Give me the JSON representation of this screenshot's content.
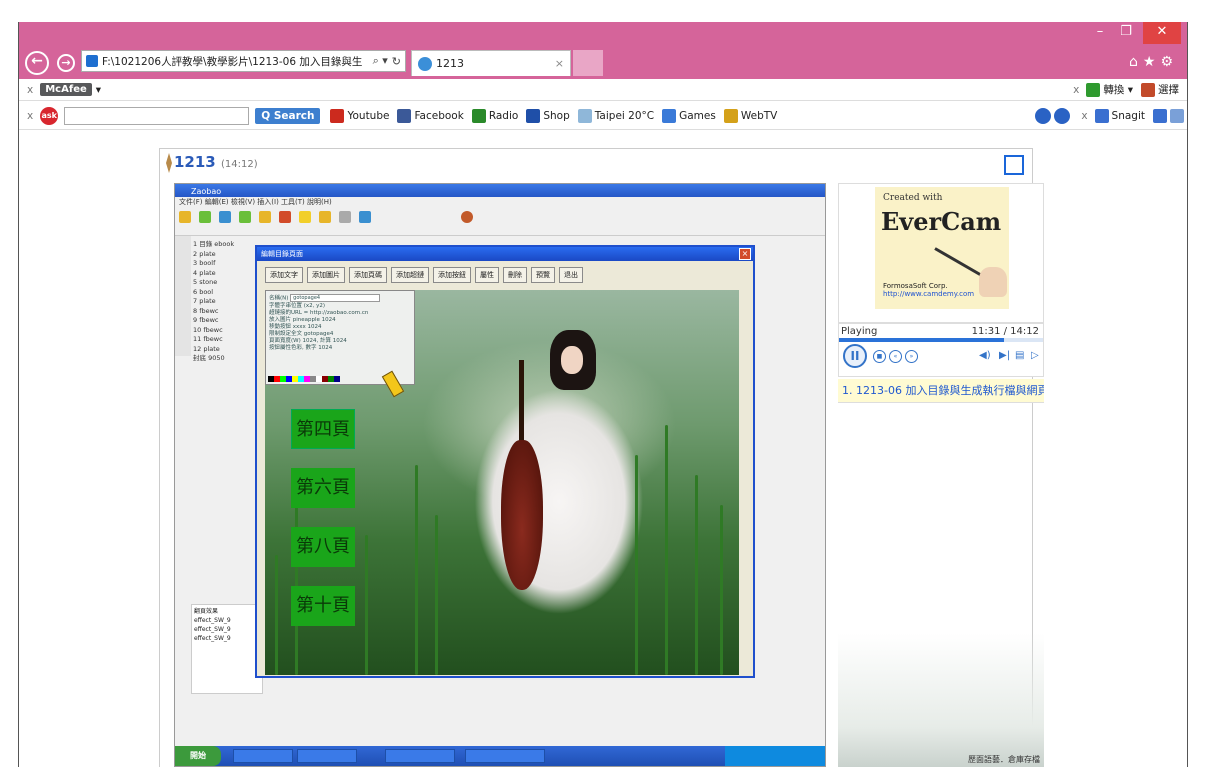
{
  "browser": {
    "address": "F:\\1021206人評教學\\教學影片\\1213-06 加入目錄與生",
    "tab_title": "1213",
    "tab_close": "×",
    "win_min": "–",
    "win_max": "❐",
    "win_close": "✕"
  },
  "toolbar1": {
    "close": "x",
    "mcafee_label": "McAfee",
    "right_close": "x",
    "translate_label": "轉換",
    "select_label": "選擇"
  },
  "toolbar2": {
    "close": "x",
    "search_button": "Search",
    "bookmarks": [
      {
        "label": "Youtube",
        "color": "#cc2a1e"
      },
      {
        "label": "Facebook",
        "color": "#3b5998"
      },
      {
        "label": "Radio",
        "color": "#2a8a2a"
      },
      {
        "label": "Shop",
        "color": "#1f4fa8"
      },
      {
        "label": "Taipei 20°C",
        "color": "#8fb7d9"
      },
      {
        "label": "Games",
        "color": "#3a7ad8"
      },
      {
        "label": "WebTV",
        "color": "#d4a11a"
      }
    ],
    "right_close": "x",
    "snagit_label": "Snagit"
  },
  "lesson": {
    "title": "1213",
    "duration": "(14:12)"
  },
  "video": {
    "app_title": "Zaobao",
    "dialog_title": "編輯目錄頁面",
    "dialog_buttons": [
      "添加文字",
      "添加圖片",
      "添加頁碼",
      "添加超鏈",
      "添加按鈕",
      "屬性",
      "刪除",
      "預覽",
      "退出"
    ],
    "popup_label": "名稱(N)",
    "popup_value": "gotopage4",
    "popup_lines": [
      "字體字串位置 (x2, y2)",
      "超鏈接的URL = http://zaobao.com.cn",
      "放入圖片 pineapple 1024",
      "移動按鈕 xxxx 1024",
      "限制設定全文 gotopage4",
      "頁面寬度(W) 1024, 計算 1024",
      "按鈕屬性色彩, 數字 1024"
    ],
    "page_buttons": [
      "第四頁",
      "第六頁",
      "第八頁",
      "第十頁"
    ],
    "start_label": "開始"
  },
  "player": {
    "evercam_created": "Created with",
    "evercam_brand": "EverCam",
    "evercam_corp": "FormosaSoft Corp.",
    "evercam_url": "http://www.camdemy.com",
    "status": "Playing",
    "time": "11:31 / 14:12",
    "progress": 0.81,
    "playlist_item": "1. 1213-06 加入目錄與生成執行檔與網頁檔",
    "footer_caption": "歷面語藝．倉庫存檔"
  }
}
